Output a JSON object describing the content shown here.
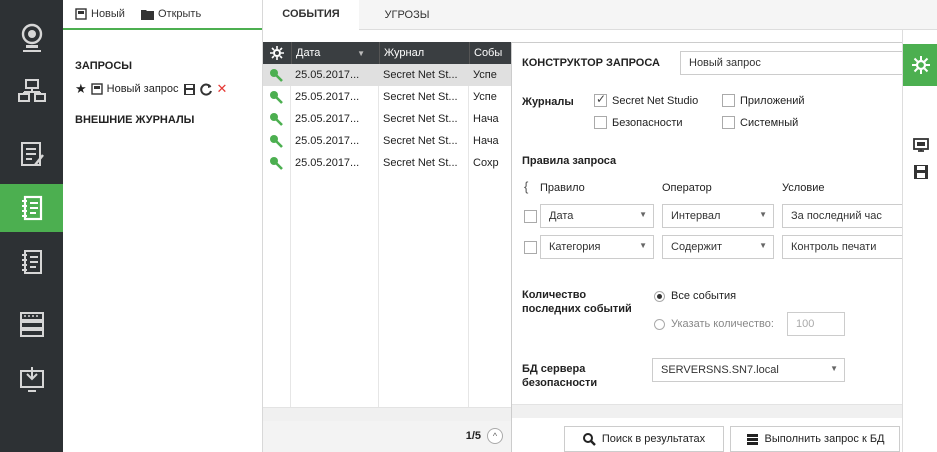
{
  "toolbar": {
    "new_label": "Новый",
    "open_label": "Открыть"
  },
  "queries": {
    "section_title": "ЗАПРОСЫ",
    "item_label": "Новый запрос",
    "external_title": "ВНЕШНИЕ ЖУРНАЛЫ"
  },
  "tabs": {
    "events": "СОБЫТИЯ",
    "threats": "УГРОЗЫ"
  },
  "grid": {
    "columns": {
      "date": "Дата",
      "journal": "Журнал",
      "event": "Собы"
    },
    "rows": [
      {
        "date": "25.05.2017...",
        "journal": "Secret Net St...",
        "event": "Успе"
      },
      {
        "date": "25.05.2017...",
        "journal": "Secret Net St...",
        "event": "Успе"
      },
      {
        "date": "25.05.2017...",
        "journal": "Secret Net St...",
        "event": "Нача"
      },
      {
        "date": "25.05.2017...",
        "journal": "Secret Net St...",
        "event": "Нача"
      },
      {
        "date": "25.05.2017...",
        "journal": "Secret Net St...",
        "event": "Сохр"
      }
    ],
    "pager": "1/5"
  },
  "constructor": {
    "title": "КОНСТРУКТОР ЗАПРОСА",
    "query_name": "Новый запрос",
    "journals_label": "Журналы",
    "journals": {
      "secret_net": "Secret Net Studio",
      "apps": "Приложений",
      "security": "Безопасности",
      "system": "Системный"
    },
    "rules_label": "Правила запроса",
    "rule_headers": {
      "rule": "Правило",
      "operator": "Оператор",
      "condition": "Условие"
    },
    "rules": [
      {
        "rule": "Дата",
        "operator": "Интервал",
        "condition": "За последний час"
      },
      {
        "rule": "Категория",
        "operator": "Содержит",
        "condition": "Контроль печати"
      }
    ],
    "count_label_1": "Количество",
    "count_label_2": "последних событий",
    "all_events": "Все события",
    "specify_count": "Указать количество:",
    "count_value": "100",
    "db_label_1": "БД сервера",
    "db_label_2": "безопасности",
    "db_value": "SERVERSNS.SN7.local",
    "search_button": "Поиск в результатах",
    "run_button": "Выполнить запрос к БД"
  },
  "colors": {
    "accent": "#4caf50",
    "rail": "#2d3134",
    "grid_header": "#3a3e41"
  }
}
